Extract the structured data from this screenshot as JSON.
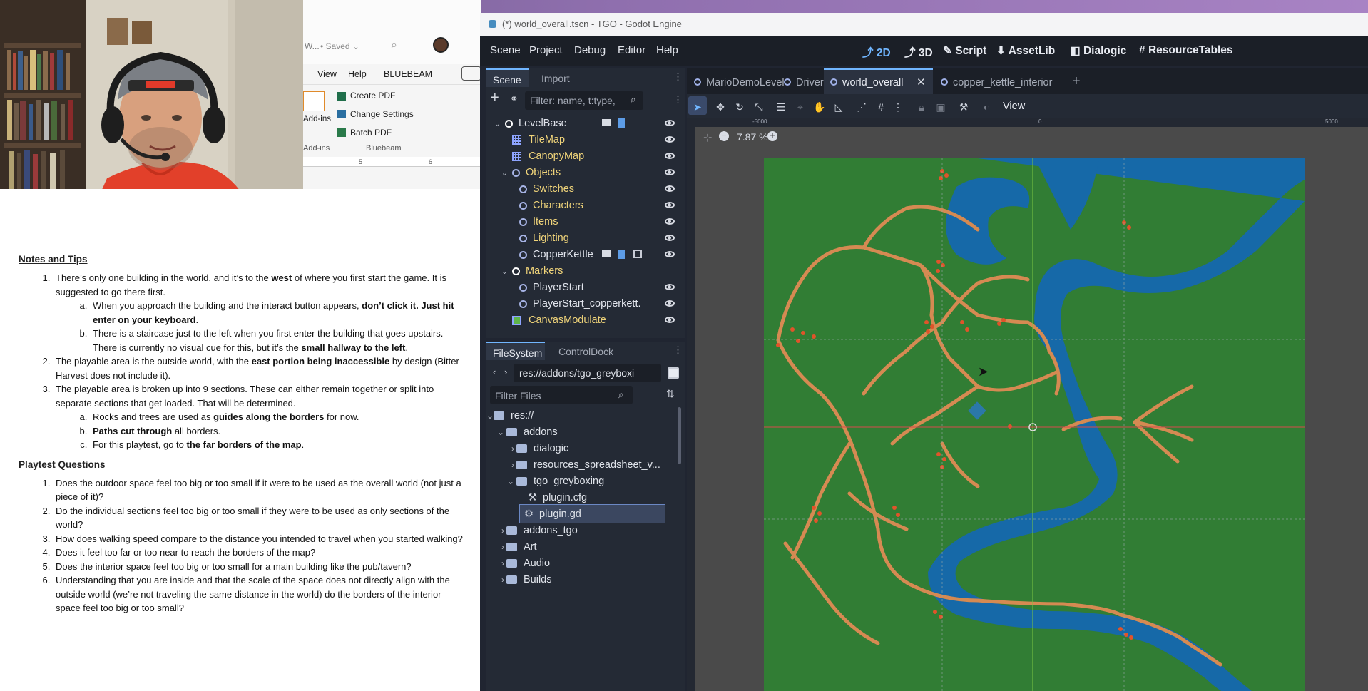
{
  "word": {
    "title_fragment": "W...",
    "saved": "• Saved ⌄",
    "menu": [
      "View",
      "Help",
      "BLUEBEAM"
    ],
    "ribbon": {
      "addins_top": "Add-ins",
      "addins_group": "Add-ins",
      "create_pdf": "Create PDF",
      "change_settings": "Change Settings",
      "batch_pdf": "Batch PDF",
      "group_label": "Bluebeam"
    },
    "ruler": [
      "5",
      "6"
    ]
  },
  "doc": {
    "notes_heading": "Notes and Tips",
    "notes": [
      {
        "pre": "There’s only one building in the world, and it’s to the ",
        "b": "west",
        "post": " of where you first start the game. It is suggested to go there first.",
        "sub": [
          {
            "pre": "When you approach the building and the interact button appears, ",
            "b": "don’t click it. Just hit enter on your keyboard",
            "post": "."
          },
          {
            "pre": "There is a staircase just to the left when you first enter the building that goes upstairs. There is currently no visual cue for this, but it’s the ",
            "b": "small hallway to the left",
            "post": "."
          }
        ]
      },
      {
        "pre": "The playable area is the outside world, with the ",
        "b": "east portion being inaccessible",
        "post": " by design (Bitter Harvest does not include it).",
        "sub": []
      },
      {
        "pre": "The playable area is broken up into 9 sections. These can either remain together or split into separate sections that get loaded. That will be determined.",
        "b": "",
        "post": "",
        "sub": [
          {
            "pre": "Rocks and trees are used as ",
            "b": "guides along the borders",
            "post": " for now."
          },
          {
            "pre": "",
            "b": "Paths cut through",
            "post": " all borders."
          },
          {
            "pre": "For this playtest, go to ",
            "b": "the far borders of the map",
            "post": "."
          }
        ]
      }
    ],
    "questions_heading": "Playtest Questions",
    "questions": [
      "Does the outdoor space feel too big or too small if it were to be used as the overall world (not just a piece of it)?",
      "Do the individual sections feel too big or too small if they were to be used as only sections of the world?",
      "How does walking speed compare to the distance you intended to travel when you started walking?",
      "Does it feel too far or too near to reach the borders of the map?",
      "Does the interior space feel too big or too small for a main building like the pub/tavern?",
      "Understanding that you are inside and that the scale of the space does not directly align with the outside world (we’re not traveling the same distance in the world) do the borders of the interior space feel too big or too small?"
    ]
  },
  "godot": {
    "title": "(*) world_overall.tscn - TGO - Godot Engine",
    "menu": [
      "Scene",
      "Project",
      "Debug",
      "Editor",
      "Help"
    ],
    "workspaces": [
      {
        "label": "2D",
        "icon": "2d-icon"
      },
      {
        "label": "3D",
        "icon": "3d-icon"
      },
      {
        "label": "Script",
        "icon": "script-icon"
      },
      {
        "label": "AssetLib",
        "icon": "assetlib-icon"
      },
      {
        "label": "Dialogic",
        "icon": "dialogic-icon"
      },
      {
        "label": "ResourceTables",
        "icon": "resourcetables-icon"
      }
    ],
    "scene_dock": {
      "tabs": [
        "Scene",
        "Import"
      ],
      "filter_placeholder": "Filter: name, t:type,",
      "nodes": [
        {
          "label": "LevelBase",
          "depth": 0
        },
        {
          "label": "TileMap",
          "depth": 1
        },
        {
          "label": "CanopyMap",
          "depth": 1
        },
        {
          "label": "Objects",
          "depth": 1
        },
        {
          "label": "Switches",
          "depth": 2
        },
        {
          "label": "Characters",
          "depth": 2
        },
        {
          "label": "Items",
          "depth": 2
        },
        {
          "label": "Lighting",
          "depth": 2
        },
        {
          "label": "CopperKettle",
          "depth": 2
        },
        {
          "label": "Markers",
          "depth": 1
        },
        {
          "label": "PlayerStart",
          "depth": 2
        },
        {
          "label": "PlayerStart_copperkett...",
          "depth": 2
        },
        {
          "label": "CanvasModulate",
          "depth": 1
        }
      ]
    },
    "filesystem": {
      "tabs": [
        "FileSystem",
        "ControlDock"
      ],
      "path": "res://addons/tgo_greyboxi",
      "filter_placeholder": "Filter Files",
      "items": [
        {
          "label": "res://"
        },
        {
          "label": "addons"
        },
        {
          "label": "dialogic"
        },
        {
          "label": "resources_spreadsheet_v..."
        },
        {
          "label": "tgo_greyboxing"
        },
        {
          "label": "plugin.cfg"
        },
        {
          "label": "plugin.gd"
        },
        {
          "label": "addons_tgo"
        },
        {
          "label": "Art"
        },
        {
          "label": "Audio"
        },
        {
          "label": "Builds"
        }
      ]
    },
    "scene_tabs": [
      "MarioDemoLevel",
      "Driver",
      "world_overall",
      "copper_kettle_interior"
    ],
    "active_tab": "world_overall",
    "toolbar_view": "View",
    "zoom": "7.87 %",
    "ruler_labels": [
      "-5000",
      "0",
      "5000"
    ]
  }
}
